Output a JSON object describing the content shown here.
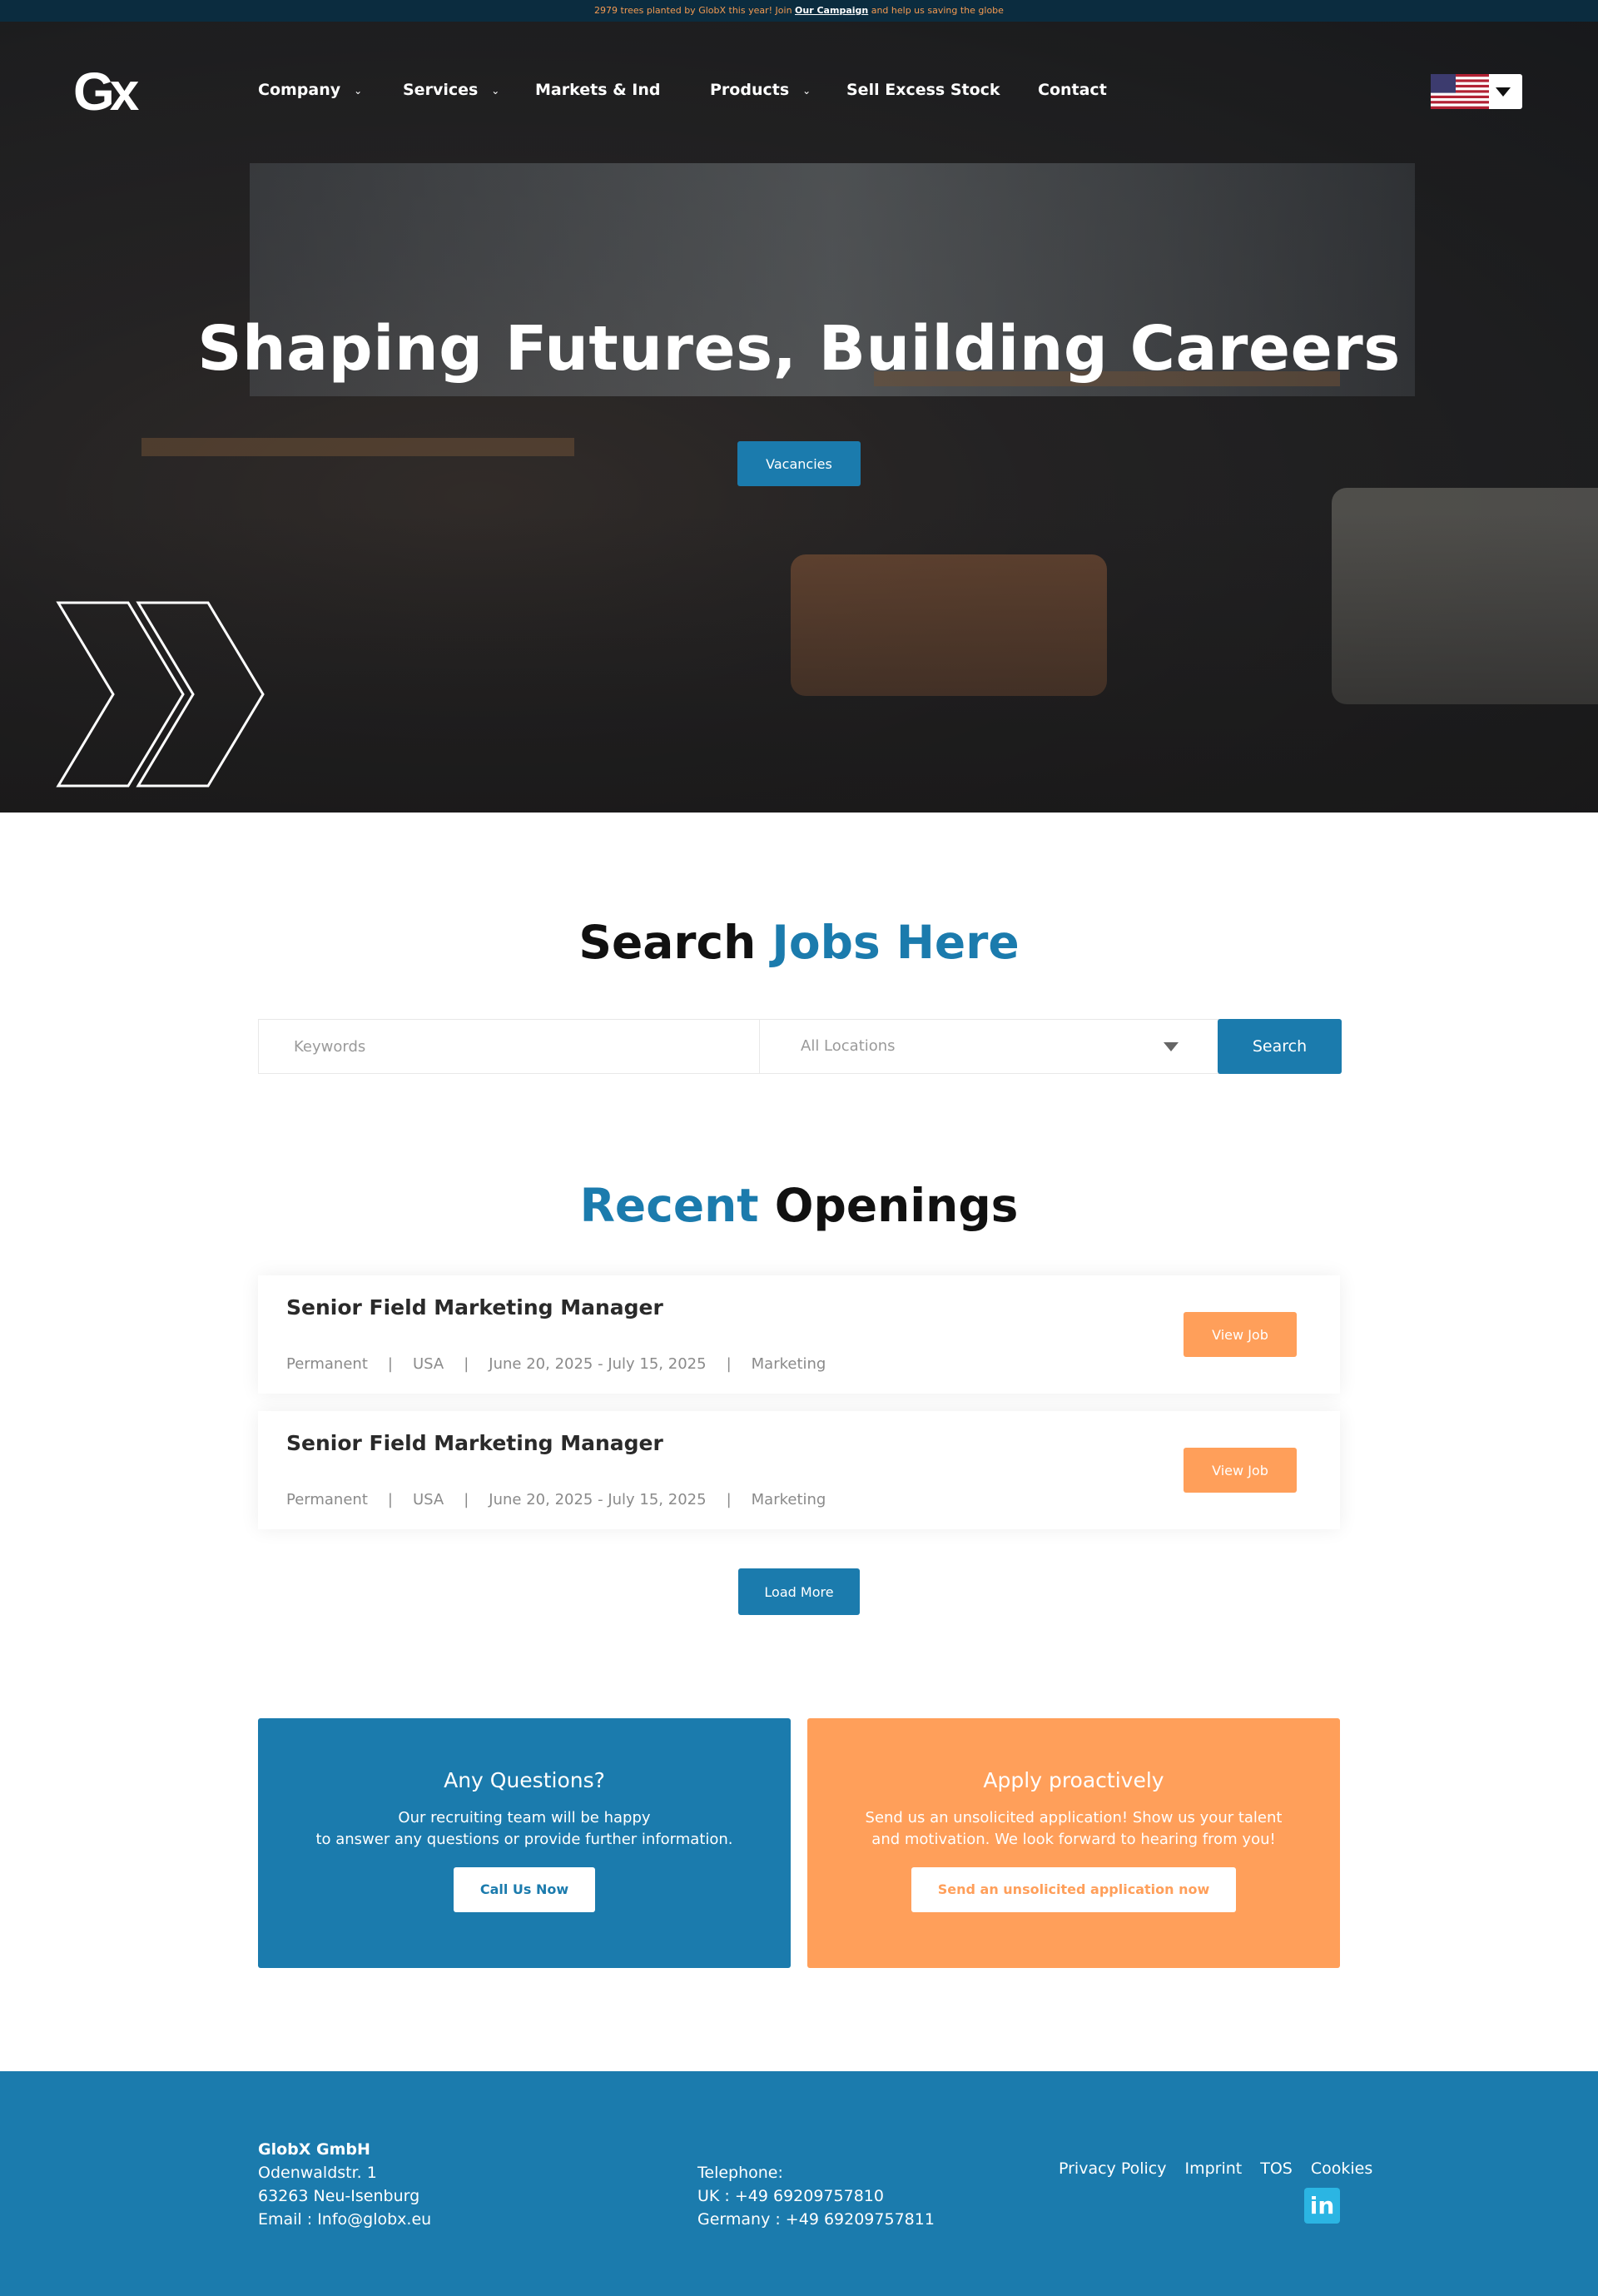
{
  "announcement": {
    "prefix": "2979 trees planted by GlobX this year! Join ",
    "link": "Our Campaign",
    "suffix": " and help us saving the globe"
  },
  "logo": {
    "text": "Gx"
  },
  "nav": {
    "items": [
      {
        "label": "Company",
        "has_dropdown": true
      },
      {
        "label": "Services",
        "has_dropdown": true
      },
      {
        "label": "Markets & Ind",
        "has_dropdown": false
      },
      {
        "label": "Products",
        "has_dropdown": true
      },
      {
        "label": "Sell Excess Stock",
        "has_dropdown": false
      },
      {
        "label": "Contact",
        "has_dropdown": false
      }
    ],
    "language_flag": "us-flag-icon"
  },
  "hero": {
    "title": "Shaping Futures, Building Careers",
    "button": "Vacancies"
  },
  "search": {
    "title_plain": "Search ",
    "title_accent": "Jobs Here",
    "keywords_placeholder": "Keywords",
    "location_value": "All Locations",
    "button": "Search"
  },
  "openings": {
    "title_accent": "Recent",
    "title_plain": " Openings",
    "jobs": [
      {
        "title": "Senior Field Marketing Manager",
        "type": "Permanent",
        "location": "USA",
        "dates": "June 20, 2025 - July 15, 2025",
        "category": "Marketing",
        "button": "View Job"
      },
      {
        "title": "Senior Field Marketing Manager",
        "type": "Permanent",
        "location": "USA",
        "dates": "June 20, 2025 - July 15, 2025",
        "category": "Marketing",
        "button": "View Job"
      }
    ],
    "load_more": "Load More"
  },
  "questions": {
    "title": "Any Questions?",
    "line1": "Our recruiting team will be happy",
    "line2": "to answer any questions or provide further information.",
    "button": "Call Us Now"
  },
  "apply": {
    "title": "Apply proactively",
    "line1": "Send us an unsolicited application! Show us your talent",
    "line2": "and motivation. We look forward to hearing from you!",
    "button": "Send an unsolicited application now"
  },
  "footer": {
    "company": "GlobX GmbH",
    "street": "Odenwaldstr. 1",
    "city": "63263 Neu-Isenburg",
    "email": "Email : Info@globx.eu",
    "phone_label": "Telephone:",
    "phone_uk": "UK : +49 69209757810",
    "phone_de": "Germany : +49 69209757811",
    "links": [
      "Privacy Policy",
      "Imprint",
      "TOS",
      "Cookies"
    ],
    "social_icon": "linkedin-icon"
  },
  "colors": {
    "primary_blue": "#1b7bad",
    "accent_orange": "#ff9f5a",
    "announcement_bg": "#0b2c3f",
    "announcement_text": "#f39a52"
  }
}
